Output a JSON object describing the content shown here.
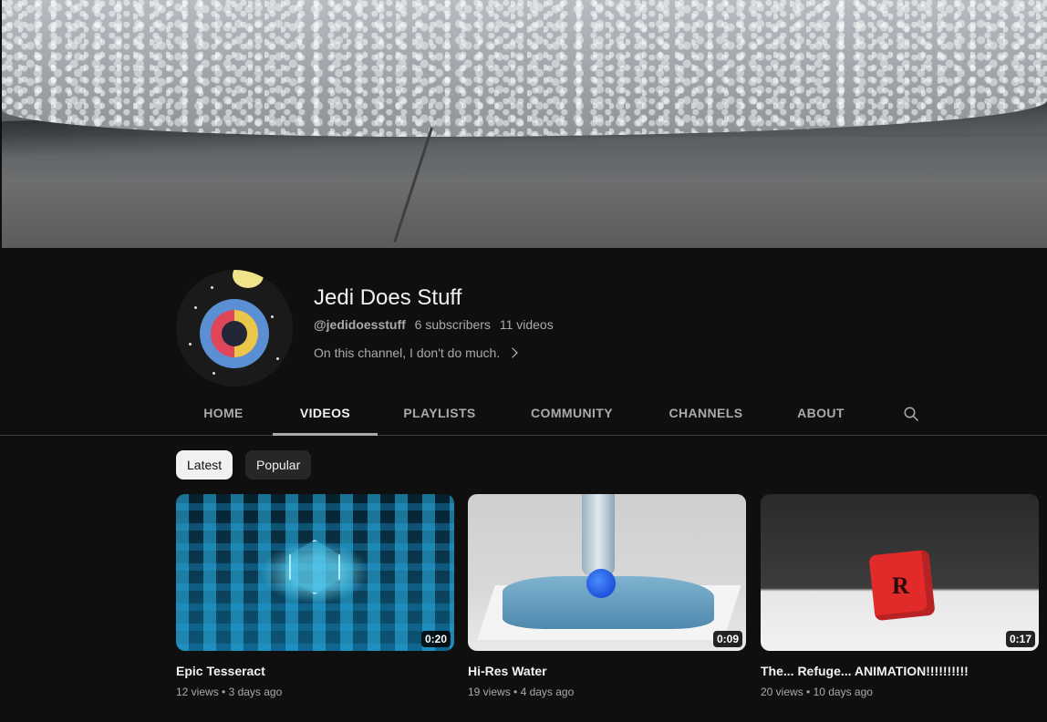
{
  "channel": {
    "name": "Jedi Does Stuff",
    "handle": "@jedidoesstuff",
    "subscribers": "6 subscribers",
    "video_count": "11 videos",
    "description": "On this channel, I don't do much."
  },
  "tabs": [
    {
      "label": "HOME"
    },
    {
      "label": "VIDEOS",
      "active": true
    },
    {
      "label": "PLAYLISTS"
    },
    {
      "label": "COMMUNITY"
    },
    {
      "label": "CHANNELS"
    },
    {
      "label": "ABOUT"
    }
  ],
  "filters": [
    {
      "label": "Latest",
      "selected": true
    },
    {
      "label": "Popular"
    }
  ],
  "videos": [
    {
      "title": "Epic Tesseract",
      "views": "12 views",
      "age": "3 days ago",
      "duration": "0:20"
    },
    {
      "title": "Hi-Res Water",
      "views": "19 views",
      "age": "4 days ago",
      "duration": "0:09"
    },
    {
      "title": "The... Refuge... ANIMATION!!!!!!!!!!",
      "views": "20 views",
      "age": "10 days ago",
      "duration": "0:17",
      "thumbnail_letter": "R"
    }
  ],
  "colors": {
    "background": "#0f0f0f",
    "text_primary": "#f1f1f1",
    "text_secondary": "#aaaaaa",
    "chip_selected": "#f1f1f1",
    "chip_normal": "#272727"
  },
  "icons": [
    "search-icon",
    "chevron-right-icon"
  ]
}
